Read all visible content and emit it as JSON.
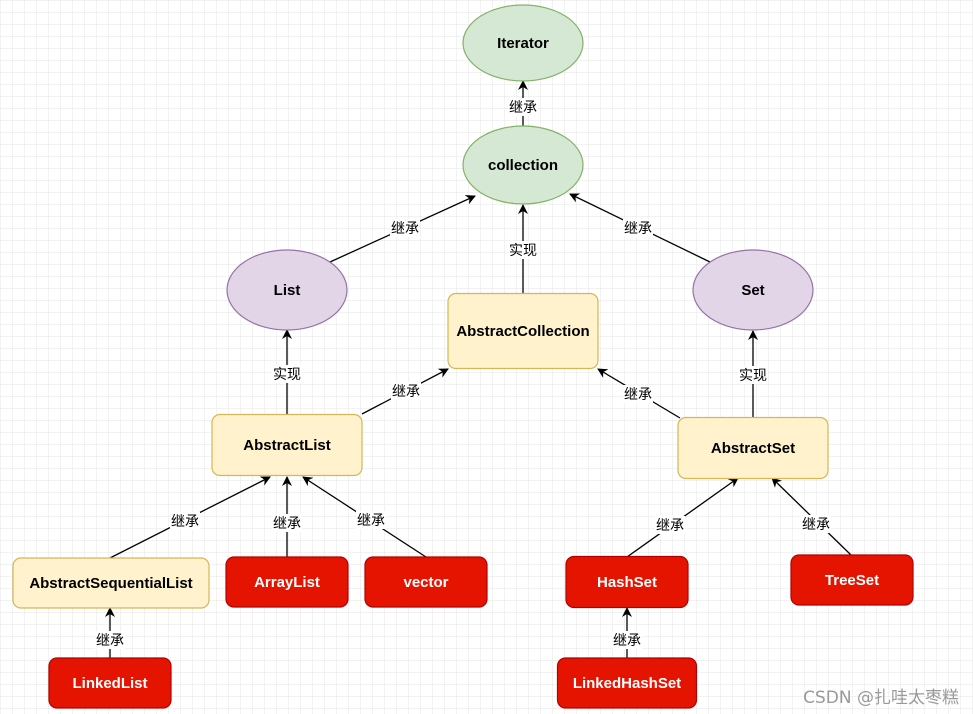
{
  "diagram": {
    "nodes": [
      {
        "id": "iterator",
        "label": "Iterator",
        "shape": "ellipse",
        "kind": "green"
      },
      {
        "id": "collection",
        "label": "collection",
        "shape": "ellipse",
        "kind": "green"
      },
      {
        "id": "list",
        "label": "List",
        "shape": "ellipse",
        "kind": "purple"
      },
      {
        "id": "set",
        "label": "Set",
        "shape": "ellipse",
        "kind": "purple"
      },
      {
        "id": "abstract-collection",
        "label": "AbstractCollection",
        "shape": "rounded-rect",
        "kind": "yellow"
      },
      {
        "id": "abstract-list",
        "label": "AbstractList",
        "shape": "rounded-rect",
        "kind": "yellow"
      },
      {
        "id": "abstract-set",
        "label": "AbstractSet",
        "shape": "rounded-rect",
        "kind": "yellow"
      },
      {
        "id": "abstract-sequential-list",
        "label": "AbstractSequentialList",
        "shape": "rounded-rect",
        "kind": "yellow"
      },
      {
        "id": "array-list",
        "label": "ArrayList",
        "shape": "rounded-rect",
        "kind": "red"
      },
      {
        "id": "vector",
        "label": "vector",
        "shape": "rounded-rect",
        "kind": "red"
      },
      {
        "id": "hash-set",
        "label": "HashSet",
        "shape": "rounded-rect",
        "kind": "red"
      },
      {
        "id": "tree-set",
        "label": "TreeSet",
        "shape": "rounded-rect",
        "kind": "red"
      },
      {
        "id": "linked-list",
        "label": "LinkedList",
        "shape": "rounded-rect",
        "kind": "red"
      },
      {
        "id": "linked-hash-set",
        "label": "LinkedHashSet",
        "shape": "rounded-rect",
        "kind": "red"
      }
    ],
    "edges": [
      {
        "from": "collection",
        "to": "iterator",
        "label": "继承"
      },
      {
        "from": "list",
        "to": "collection",
        "label": "继承"
      },
      {
        "from": "abstract-collection",
        "to": "collection",
        "label": "实现"
      },
      {
        "from": "set",
        "to": "collection",
        "label": "继承"
      },
      {
        "from": "abstract-list",
        "to": "list",
        "label": "实现"
      },
      {
        "from": "abstract-list",
        "to": "abstract-collection",
        "label": "继承"
      },
      {
        "from": "abstract-set",
        "to": "set",
        "label": "实现"
      },
      {
        "from": "abstract-set",
        "to": "abstract-collection",
        "label": "继承"
      },
      {
        "from": "abstract-sequential-list",
        "to": "abstract-list",
        "label": "继承"
      },
      {
        "from": "array-list",
        "to": "abstract-list",
        "label": "继承"
      },
      {
        "from": "vector",
        "to": "abstract-list",
        "label": "继承"
      },
      {
        "from": "hash-set",
        "to": "abstract-set",
        "label": "继承"
      },
      {
        "from": "tree-set",
        "to": "abstract-set",
        "label": "继承"
      },
      {
        "from": "linked-list",
        "to": "abstract-sequential-list",
        "label": "继承"
      },
      {
        "from": "linked-hash-set",
        "to": "hash-set",
        "label": "继承"
      }
    ],
    "colors": {
      "green": {
        "fill": "#d5e8d4",
        "stroke": "#82b366",
        "text": "#000000"
      },
      "purple": {
        "fill": "#e1d5e7",
        "stroke": "#9673a6",
        "text": "#000000"
      },
      "yellow": {
        "fill": "#fff2cc",
        "stroke": "#d6b656",
        "text": "#000000"
      },
      "red": {
        "fill": "#e51400",
        "stroke": "#b20000",
        "text": "#ffffff"
      },
      "grid": "#e4e4e4"
    }
  },
  "watermark": "CSDN @扎哇太枣糕"
}
